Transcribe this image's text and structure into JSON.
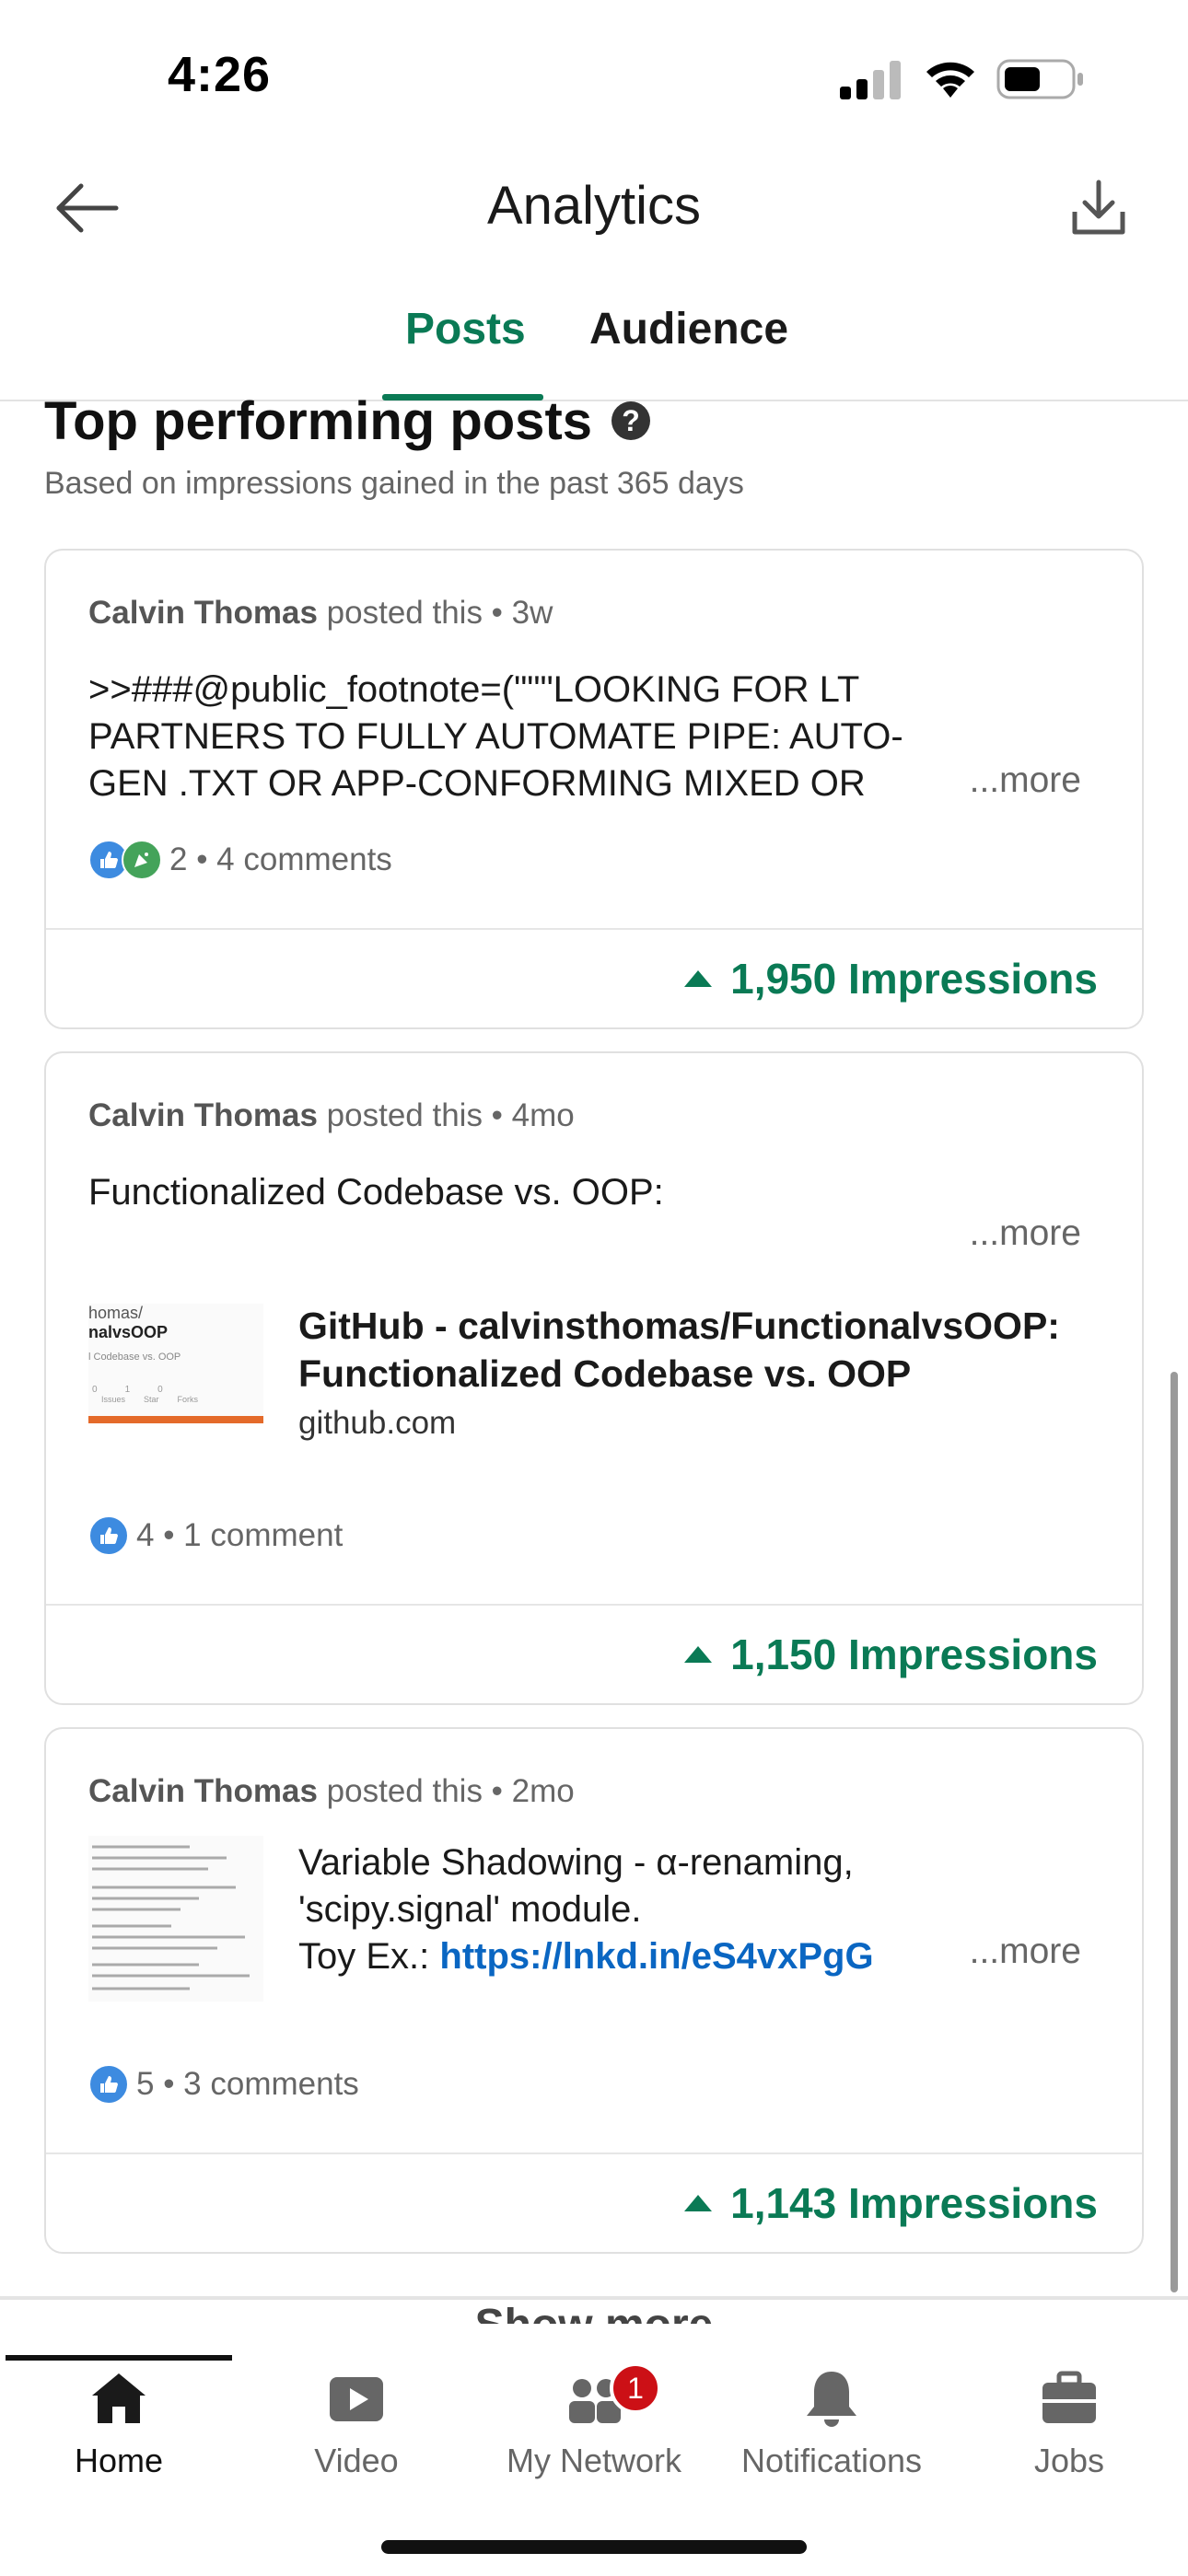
{
  "status_bar": {
    "time": "4:26"
  },
  "header": {
    "title": "Analytics"
  },
  "tabs": [
    {
      "label": "Posts",
      "active": true
    },
    {
      "label": "Audience",
      "active": false
    }
  ],
  "section": {
    "title": "Top performing posts",
    "subtitle": "Based on impressions gained in the past 365 days"
  },
  "posts": [
    {
      "author": "Calvin Thomas",
      "action": " posted this",
      "age": " • 3w",
      "text_lines": [
        ">>###@public_footnote=(\"\"\"LOOKING FOR LT",
        "PARTNERS TO FULLY AUTOMATE PIPE: AUTO-",
        "GEN .TXT OR APP-CONFORMING MIXED OR"
      ],
      "more_label": "...more",
      "reactions": "2 • 4 comments",
      "impressions": "1,950 Impressions"
    },
    {
      "author": "Calvin Thomas",
      "action": " posted this",
      "age": " • 4mo",
      "text_lines": [
        "Functionalized Codebase vs. OOP:"
      ],
      "more_label": "...more",
      "link": {
        "title": "GitHub - calvinsthomas/FunctionalvsOOP: Functionalized Codebase vs. OOP",
        "domain": "github.com",
        "thumb_line1": "homas/",
        "thumb_line2": "nalvsOOP",
        "thumb_line3": "l Codebase vs. OOP",
        "thumb_stats": [
          "0",
          "1",
          "0"
        ],
        "thumb_stat_labels": [
          "Issues",
          "Star",
          "Forks"
        ]
      },
      "reactions": "4 • 1 comment",
      "impressions": "1,150 Impressions"
    },
    {
      "author": "Calvin Thomas",
      "action": " posted this",
      "age": " • 2mo",
      "text_line1": "Variable Shadowing - α-renaming,",
      "text_line2": "'scipy.signal' module.",
      "text_line3_prefix": "Toy Ex.: ",
      "text_link": "https://lnkd.in/eS4vxPgG",
      "more_label": "...more",
      "reactions": "5 • 3 comments",
      "impressions": "1,143 Impressions"
    }
  ],
  "show_more_label": "Show more",
  "bottom_nav": [
    {
      "label": "Home",
      "icon": "home-icon",
      "active": true
    },
    {
      "label": "Video",
      "icon": "video-icon",
      "active": false
    },
    {
      "label": "My Network",
      "icon": "network-icon",
      "active": false,
      "badge": "1"
    },
    {
      "label": "Notifications",
      "icon": "bell-icon",
      "active": false
    },
    {
      "label": "Jobs",
      "icon": "briefcase-icon",
      "active": false
    }
  ],
  "colors": {
    "accent": "#0a7a55",
    "link": "#0a66c2",
    "badge": "#cc1016"
  }
}
